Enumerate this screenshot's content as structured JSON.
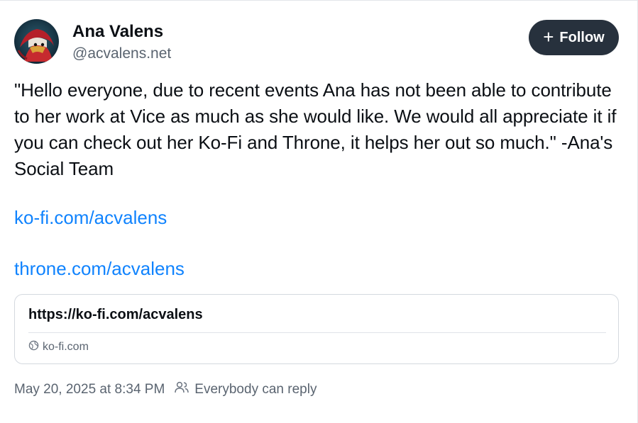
{
  "author": {
    "display_name": "Ana Valens",
    "handle": "@acvalens.net"
  },
  "follow_button": {
    "icon": "plus-icon",
    "label": "Follow"
  },
  "post": {
    "text": "\"Hello everyone, due to recent events Ana has not been able to contribute to her work at Vice as much as she would like. We would all appreciate it if you can check out her Ko-Fi and Throne, it helps her out so much.\" -Ana's Social Team",
    "links": [
      "ko-fi.com/acvalens",
      "throne.com/acvalens"
    ]
  },
  "link_card": {
    "url": "https://ko-fi.com/acvalens",
    "domain_icon": "globe-icon",
    "domain": "ko-fi.com"
  },
  "footer": {
    "timestamp": "May 20, 2025 at 8:34 PM",
    "reply_icon": "people-icon",
    "reply_setting": "Everybody can reply"
  },
  "colors": {
    "link": "#1083fe",
    "follow_button_bg": "#27313d",
    "muted_text": "#5a6470"
  }
}
